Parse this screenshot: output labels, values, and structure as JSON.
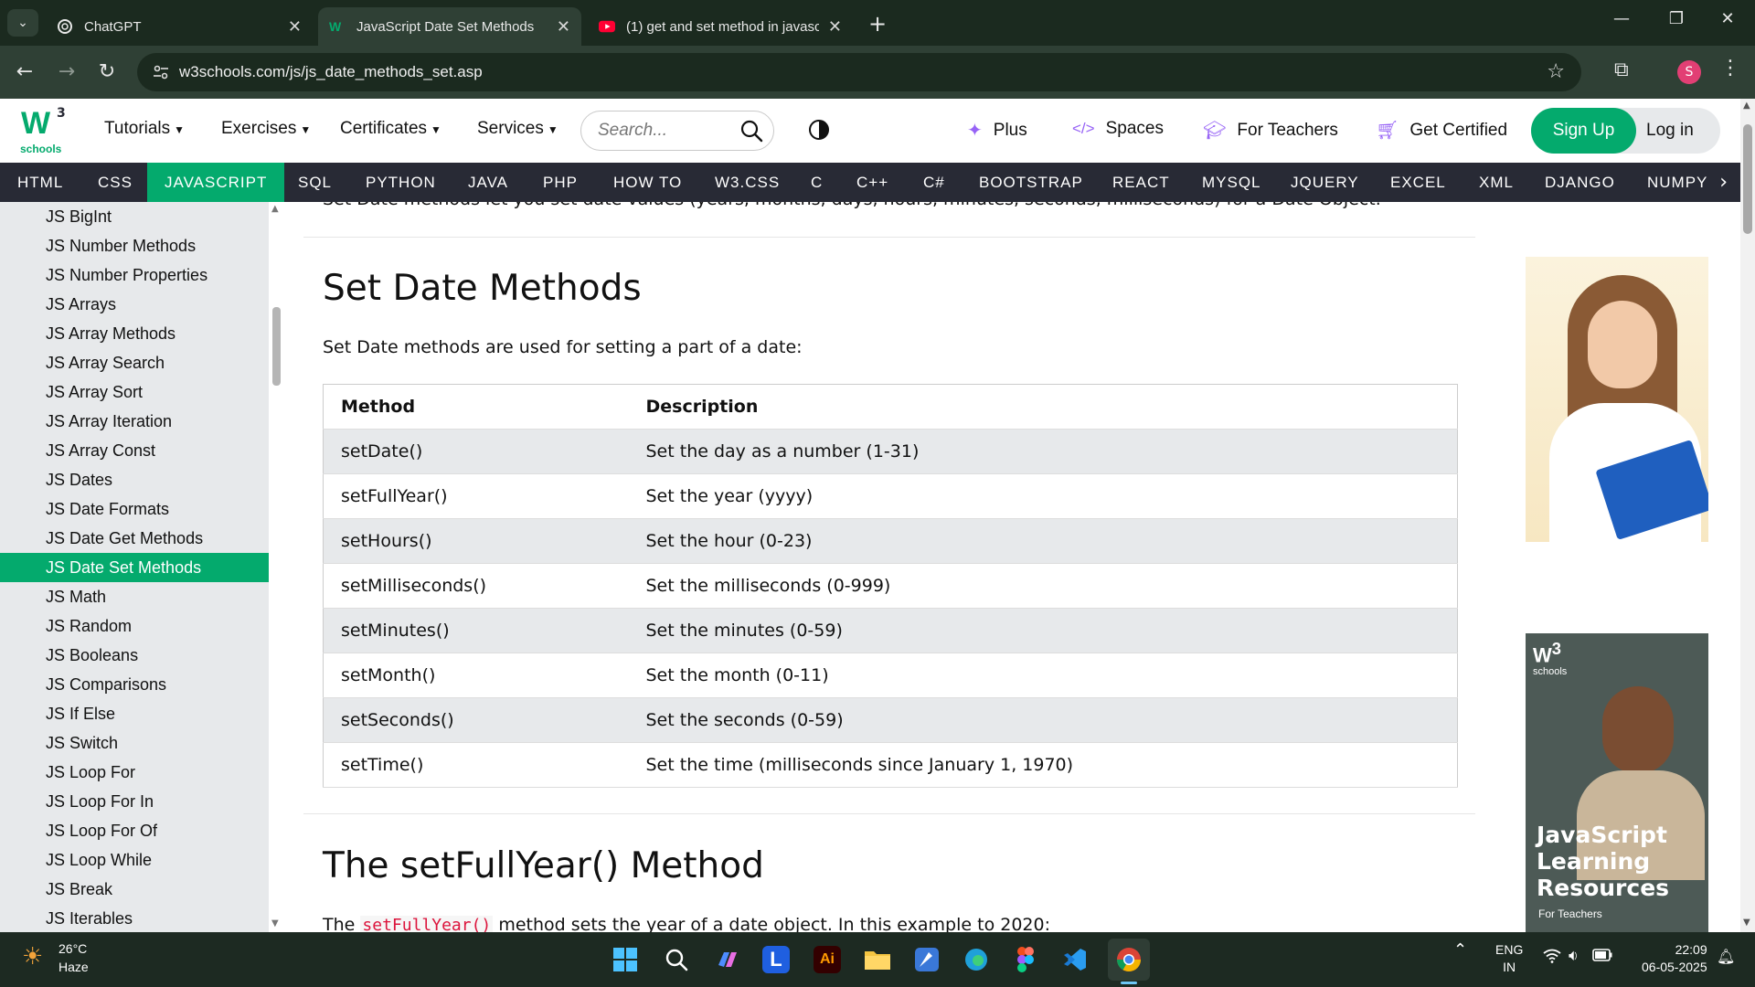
{
  "browser": {
    "tabs": [
      {
        "title": "ChatGPT",
        "icon": "chatgpt-icon"
      },
      {
        "title": "JavaScript Date Set Methods",
        "icon": "w3schools-icon"
      },
      {
        "title": "(1) get and set method in javasc",
        "icon": "youtube-icon"
      }
    ],
    "url": "w3schools.com/js/js_date_methods_set.asp",
    "profile_initial": "S"
  },
  "w3": {
    "logo_sup": "3",
    "logo_sub": "schools",
    "nav": {
      "tutorials": "Tutorials",
      "exercises": "Exercises",
      "certificates": "Certificates",
      "services": "Services"
    },
    "search_placeholder": "Search...",
    "right_links": {
      "plus": "Plus",
      "spaces": "Spaces",
      "teachers": "For Teachers",
      "certified": "Get Certified"
    },
    "signup": "Sign Up",
    "login": "Log in"
  },
  "subnav": [
    "HTML",
    "CSS",
    "JAVASCRIPT",
    "SQL",
    "PYTHON",
    "JAVA",
    "PHP",
    "HOW TO",
    "W3.CSS",
    "C",
    "C++",
    "C#",
    "BOOTSTRAP",
    "REACT",
    "MYSQL",
    "JQUERY",
    "EXCEL",
    "XML",
    "DJANGO",
    "NUMPY"
  ],
  "subnav_active": "JAVASCRIPT",
  "sidebar": {
    "items": [
      "JS BigInt",
      "JS Number Methods",
      "JS Number Properties",
      "JS Arrays",
      "JS Array Methods",
      "JS Array Search",
      "JS Array Sort",
      "JS Array Iteration",
      "JS Array Const",
      "JS Dates",
      "JS Date Formats",
      "JS Date Get Methods",
      "JS Date Set Methods",
      "JS Math",
      "JS Random",
      "JS Booleans",
      "JS Comparisons",
      "JS If Else",
      "JS Switch",
      "JS Loop For",
      "JS Loop For In",
      "JS Loop For Of",
      "JS Loop While",
      "JS Break",
      "JS Iterables"
    ],
    "active": "JS Date Set Methods"
  },
  "content": {
    "intro": "Set Date methods let you set date values (years, months, days, hours, minutes, seconds, milliseconds) for a Date Object.",
    "heading1": "Set Date Methods",
    "para1": "Set Date methods are used for setting a part of a date:",
    "table": {
      "headers": [
        "Method",
        "Description"
      ],
      "rows": [
        [
          "setDate()",
          "Set the day as a number (1-31)"
        ],
        [
          "setFullYear()",
          "Set the year (yyyy)"
        ],
        [
          "setHours()",
          "Set the hour (0-23)"
        ],
        [
          "setMilliseconds()",
          "Set the milliseconds (0-999)"
        ],
        [
          "setMinutes()",
          "Set the minutes (0-59)"
        ],
        [
          "setMonth()",
          "Set the month (0-11)"
        ],
        [
          "setSeconds()",
          "Set the seconds (0-59)"
        ],
        [
          "setTime()",
          "Set the time (milliseconds since January 1, 1970)"
        ]
      ]
    },
    "heading2": "The setFullYear() Method",
    "para2_pre": "The",
    "para2_code": "setFullYear()",
    "para2_post": "method sets the year of a date object. In this example to 2020:"
  },
  "ads": {
    "ad2_logo_sup": "3",
    "ad2_logo_sub": "schools",
    "ad2_title": "JavaScript Learning Resources",
    "ad2_sub": "For Teachers"
  },
  "taskbar": {
    "temp": "26°C",
    "weather": "Haze",
    "lang1": "ENG",
    "lang2": "IN",
    "time": "22:09",
    "date": "06-05-2025"
  },
  "colors": {
    "w3_green": "#04aa6d",
    "subnav_bg": "#282a35",
    "sidebar_bg": "#e7e9eb",
    "code_red": "#dc143c"
  }
}
